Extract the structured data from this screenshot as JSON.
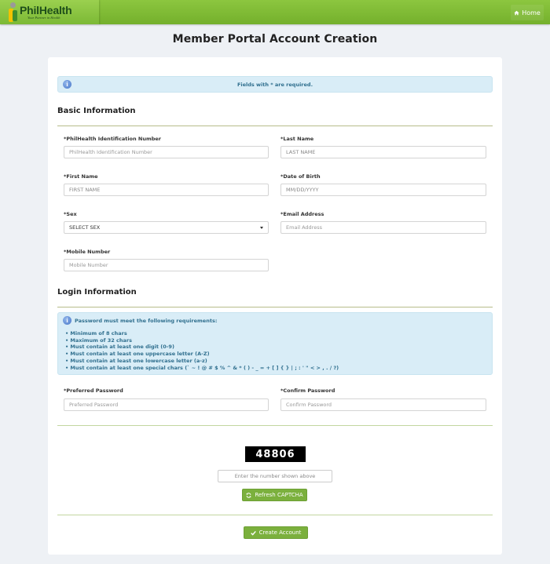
{
  "header": {
    "logo_text": "PhilHealth",
    "logo_tagline": "Your Partner in Health",
    "home_label": "Home"
  },
  "page_title": "Member Portal Account Creation",
  "notice": "Fields with * are required.",
  "sections": {
    "basic": "Basic Information",
    "login": "Login Information"
  },
  "fields": {
    "pin": {
      "label": "*PhilHealth Identification Number",
      "placeholder": "PhilHealth Identification Number",
      "value": ""
    },
    "last_name": {
      "label": "*Last Name",
      "placeholder": "LAST NAME",
      "value": ""
    },
    "first_name": {
      "label": "*First Name",
      "placeholder": "FIRST NAME",
      "value": ""
    },
    "dob": {
      "label": "*Date of Birth",
      "placeholder": "MM/DD/YYYY",
      "value": ""
    },
    "sex": {
      "label": "*Sex",
      "selected": "SELECT SEX"
    },
    "email": {
      "label": "*Email Address",
      "placeholder": "Email Address",
      "value": ""
    },
    "mobile": {
      "label": "*Mobile Number",
      "placeholder": "Mobile Number",
      "value": ""
    },
    "password": {
      "label": "*Preferred Password",
      "placeholder": "Preferred Password",
      "value": ""
    },
    "confirm_password": {
      "label": "*Confirm Password",
      "placeholder": "Confirm Password",
      "value": ""
    }
  },
  "password_rules": {
    "heading": "Password must meet the following requirements:",
    "items": [
      "Minimum of 8 chars",
      "Maximum of 32 chars",
      "Must contain at least one digit (0-9)",
      "Must contain at least one uppercase letter (A-Z)",
      "Must contain at least one lowercase letter (a-z)",
      "Must contain at least one special chars (` ~ ! @ # $ % ^ & * ( ) - _ = + [ ] { } | ; : ' \" < > , . / ?)"
    ]
  },
  "captcha": {
    "code": "48806",
    "input_placeholder": "Enter the number shown above",
    "refresh_label": "Refresh CAPTCHA"
  },
  "submit_label": "Create Account",
  "icons": {
    "home": "home-icon",
    "info": "info-icon",
    "refresh": "refresh-icon",
    "check": "check-icon",
    "caret": "caret-down-icon"
  },
  "colors": {
    "brand_green": "#7bb03d",
    "alert_bg": "#d9edf7",
    "alert_text": "#31708f"
  }
}
